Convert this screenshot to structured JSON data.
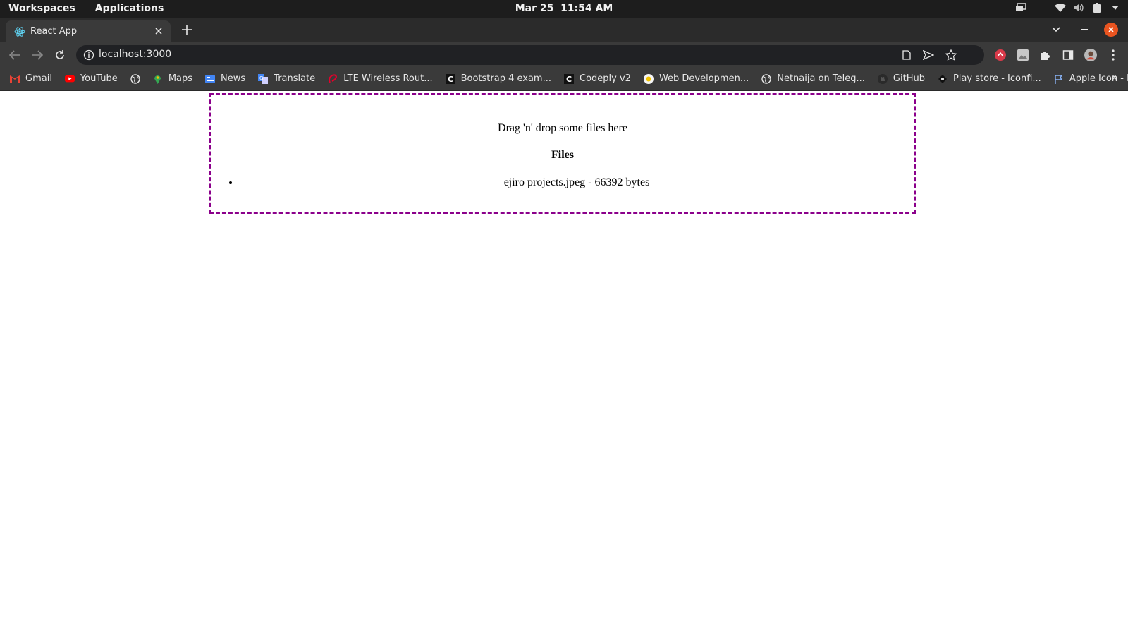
{
  "os": {
    "workspaces": "Workspaces",
    "applications": "Applications",
    "date": "Mar 25",
    "time": "11:54 AM"
  },
  "browser": {
    "tab_title": "React App",
    "url": "localhost:3000",
    "bookmarks": [
      "Gmail",
      "YouTube",
      "",
      "Maps",
      "News",
      "Translate",
      "LTE Wireless Rout...",
      "Bootstrap 4 exam...",
      "Codeply v2",
      "Web Developmen...",
      "Netnaija on Teleg...",
      "GitHub",
      "Play store - Iconfi...",
      "Apple Icon - Bran..."
    ],
    "more_bookmarks": "»"
  },
  "page": {
    "dropzone_text": "Drag 'n' drop some files here",
    "files_heading": "Files",
    "files": [
      {
        "name": "ejiro projects.jpeg",
        "size": "66392 bytes"
      }
    ]
  },
  "colors": {
    "dropzone_border": "#8b008b",
    "accent_close": "#e95420"
  }
}
